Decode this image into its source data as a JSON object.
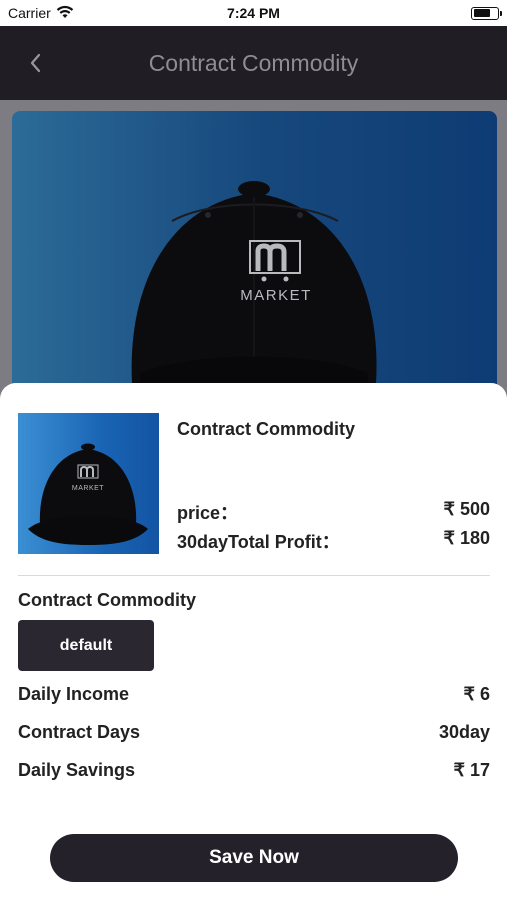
{
  "status_bar": {
    "carrier": "Carrier",
    "time": "7:24 PM"
  },
  "nav": {
    "title": "Contract Commodity"
  },
  "hero": {
    "logo_text": "MARKET",
    "logo_letter": "m"
  },
  "product": {
    "title": "Contract Commodity",
    "price_label": "price：",
    "price_value": "₹ 500",
    "profit_label": "30dayTotal Profit：",
    "profit_value": "₹ 180",
    "thumb_logo_text": "MARKET",
    "thumb_logo_letter": "m"
  },
  "spec": {
    "section_title": "Contract Commodity",
    "option_label": "default"
  },
  "details": [
    {
      "label": "Daily Income",
      "value": "₹ 6"
    },
    {
      "label": "Contract Days",
      "value": "30day"
    },
    {
      "label": "Daily Savings",
      "value": "₹ 17"
    }
  ],
  "actions": {
    "save_label": "Save Now"
  },
  "colors": {
    "nav_bg": "#201d24",
    "button_bg": "#24212a",
    "overlay": "#7d7c82"
  }
}
